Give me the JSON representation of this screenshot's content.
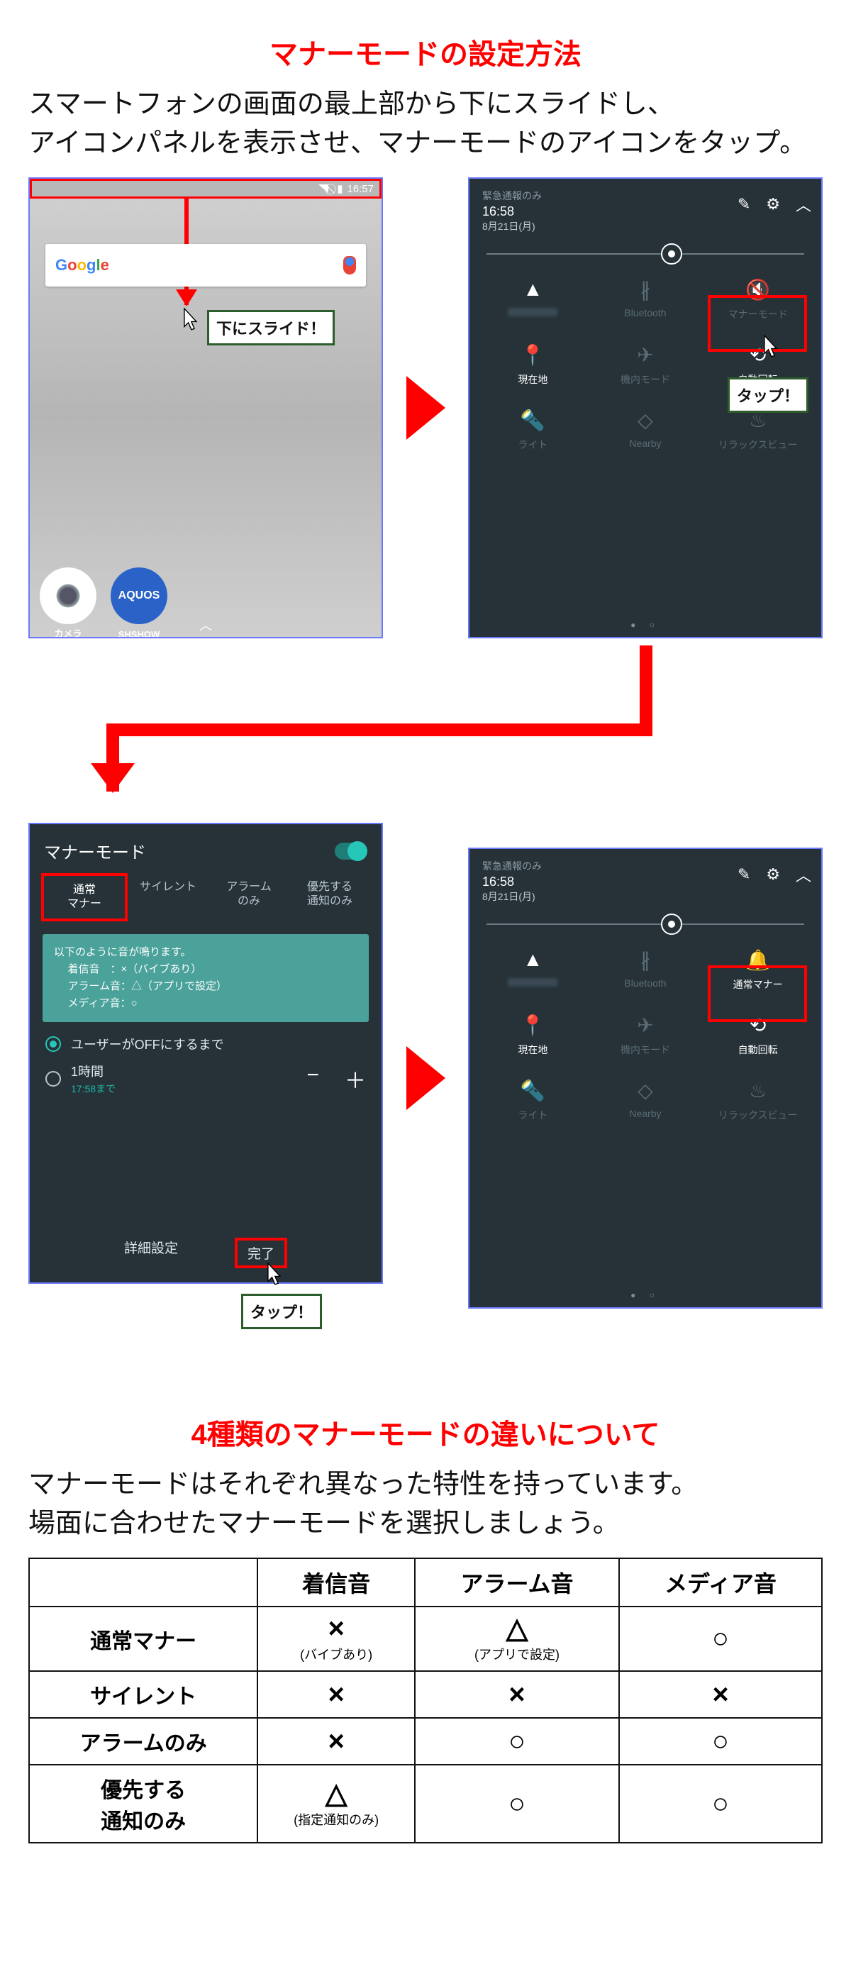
{
  "titles": {
    "main1": "マナーモードの設定方法",
    "desc1a": "スマートフォンの画面の最上部から下にスライドし、",
    "desc1b": "アイコンパネルを表示させ、マナーモードのアイコンをタップ。",
    "main2": "4種類のマナーモードの違いについて",
    "desc2a": "マナーモードはそれぞれ異なった特性を持っています。",
    "desc2b": "場面に合わせたマナーモードを選択しましょう。"
  },
  "tags": {
    "slide": "下にスライド！",
    "tap": "タップ！"
  },
  "phone1": {
    "clock": "16:57",
    "google": "Google",
    "apps": {
      "camera": "カメラ",
      "aquos": "AQUOS",
      "shshow": "SHSHOW"
    }
  },
  "qs": {
    "status": "緊急通報のみ",
    "time": "16:58",
    "date": "8月21日(月)",
    "items": {
      "wifi": "",
      "bluetooth": "Bluetooth",
      "manner_off": "マナーモード",
      "manner_on": "通常マナー",
      "location": "現在地",
      "airplane": "機内モード",
      "autorotate": "自動回転",
      "light": "ライト",
      "nearby": "Nearby",
      "relax": "リラックスビュー"
    }
  },
  "dialog": {
    "title": "マナーモード",
    "tabs": [
      "通常\nマナー",
      "サイレント",
      "アラーム\nのみ",
      "優先する\n通知のみ"
    ],
    "info_head": "以下のように音が鳴ります。",
    "info_lines": [
      "着信音　：×（バイブあり）",
      "アラーム音：△（アプリで設定）",
      "メディア音：○"
    ],
    "radio1": "ユーザーがOFFにするまで",
    "hour": "1時間",
    "hour_sub": "17:58まで",
    "detail": "詳細設定",
    "done": "完了"
  },
  "table": {
    "cols": [
      "",
      "着信音",
      "アラーム音",
      "メディア音"
    ],
    "rows": [
      {
        "name": "通常マナー",
        "cells": [
          "× (バイブあり)",
          "△ (アプリで設定)",
          "○"
        ]
      },
      {
        "name": "サイレント",
        "cells": [
          "×",
          "×",
          "×"
        ]
      },
      {
        "name": "アラームのみ",
        "cells": [
          "×",
          "○",
          "○"
        ]
      },
      {
        "name": "優先する\n通知のみ",
        "cells": [
          "△ (指定通知のみ)",
          "○",
          "○"
        ]
      }
    ]
  }
}
